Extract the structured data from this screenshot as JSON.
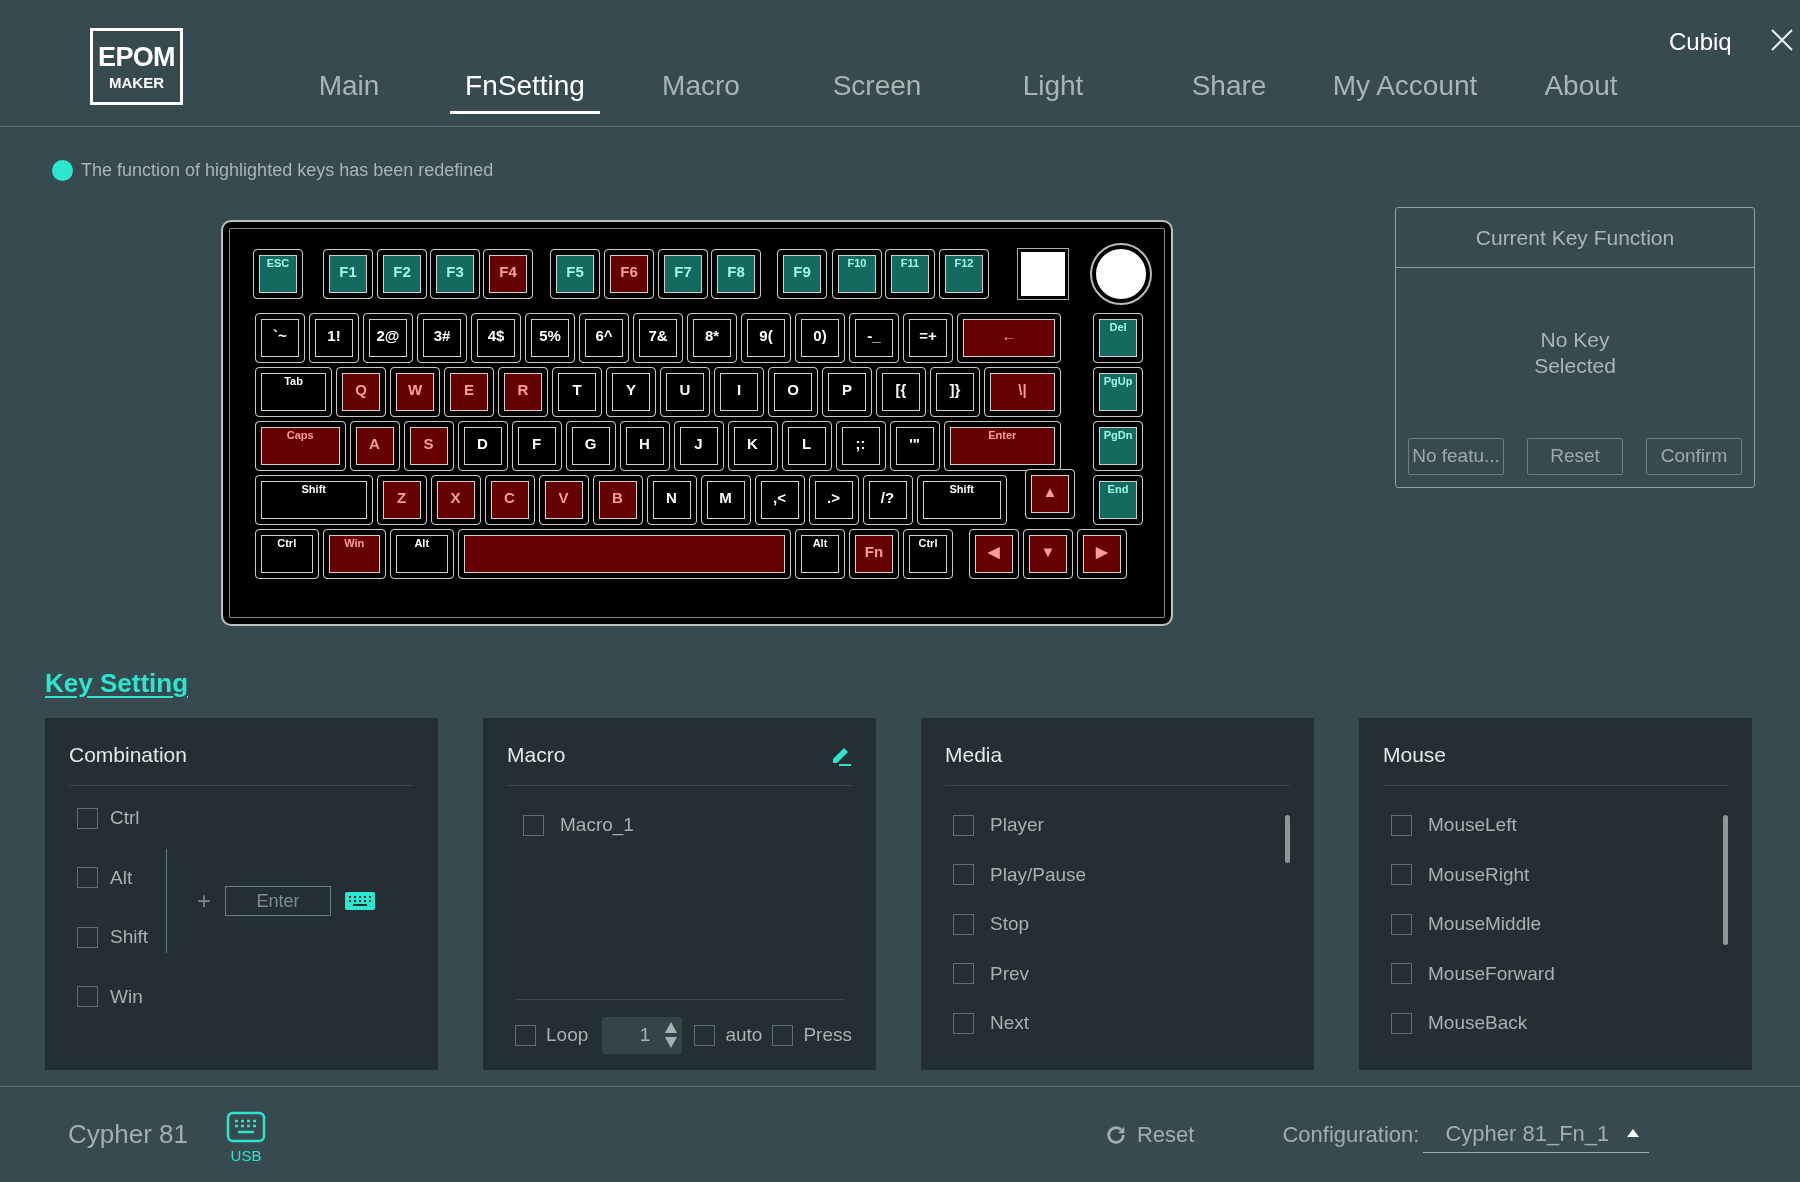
{
  "logo": {
    "line_1": "EPOM",
    "line_2": "MAKER"
  },
  "user_name": "Cubiq",
  "tabs": [
    {
      "label": "Main",
      "selected": false
    },
    {
      "label": "FnSetting",
      "selected": true
    },
    {
      "label": "Macro",
      "selected": false
    },
    {
      "label": "Screen",
      "selected": false
    },
    {
      "label": "Light",
      "selected": false
    },
    {
      "label": "Share",
      "selected": false
    },
    {
      "label": "My Account",
      "selected": false
    },
    {
      "label": "About",
      "selected": false
    }
  ],
  "notice": "The function of highlighted keys has been redefined",
  "keyboard": {
    "rows": [
      {
        "keys": [
          {
            "kind": "key",
            "label": "ESC",
            "color": "#136b5f"
          },
          {
            "kind": "key",
            "label": "F1",
            "color": "#136b5f"
          },
          {
            "kind": "key",
            "label": "F2",
            "color": "#136b5f"
          },
          {
            "kind": "key",
            "label": "F3",
            "color": "#136b5f"
          },
          {
            "kind": "key",
            "label": "F4",
            "color": "#650000"
          },
          {
            "kind": "key",
            "label": "F5",
            "color": "#136b5f"
          },
          {
            "kind": "key",
            "label": "F6",
            "color": "#650000"
          },
          {
            "kind": "key",
            "label": "F7",
            "color": "#136b5f"
          },
          {
            "kind": "key",
            "label": "F8",
            "color": "#136b5f"
          },
          {
            "kind": "key",
            "label": "F9",
            "color": "#136b5f"
          },
          {
            "kind": "key",
            "label": "F10",
            "color": "#136b5f"
          },
          {
            "kind": "key",
            "label": "F11",
            "color": "#136b5f"
          },
          {
            "kind": "key",
            "label": "F12",
            "color": "#136b5f"
          },
          {
            "kind": "screen"
          },
          {
            "kind": "knob"
          }
        ]
      },
      {
        "keys": [
          {
            "kind": "key",
            "label": "`~",
            "color": "#000000"
          },
          {
            "kind": "key",
            "label": "1!",
            "color": "#000000"
          },
          {
            "kind": "key",
            "label": "2@",
            "color": "#000000"
          },
          {
            "kind": "key",
            "label": "3#",
            "color": "#000000"
          },
          {
            "kind": "key",
            "label": "4$",
            "color": "#000000"
          },
          {
            "kind": "key",
            "label": "5%",
            "color": "#000000"
          },
          {
            "kind": "key",
            "label": "6^",
            "color": "#000000"
          },
          {
            "kind": "key",
            "label": "7&",
            "color": "#000000"
          },
          {
            "kind": "key",
            "label": "8*",
            "color": "#000000"
          },
          {
            "kind": "key",
            "label": "9(",
            "color": "#000000"
          },
          {
            "kind": "key",
            "label": "0)",
            "color": "#000000"
          },
          {
            "kind": "key",
            "label": "-_",
            "color": "#000000"
          },
          {
            "kind": "key",
            "label": "=+",
            "color": "#000000"
          },
          {
            "kind": "key",
            "label": "←",
            "color": "#650000"
          },
          {
            "kind": "key",
            "label": "Del",
            "color": "#136b5f"
          }
        ]
      },
      {
        "keys": [
          {
            "kind": "key",
            "label": "Tab",
            "color": "#000000"
          },
          {
            "kind": "key",
            "label": "Q",
            "color": "#650000"
          },
          {
            "kind": "key",
            "label": "W",
            "color": "#650000"
          },
          {
            "kind": "key",
            "label": "E",
            "color": "#650000"
          },
          {
            "kind": "key",
            "label": "R",
            "color": "#650000"
          },
          {
            "kind": "key",
            "label": "T",
            "color": "#000000"
          },
          {
            "kind": "key",
            "label": "Y",
            "color": "#000000"
          },
          {
            "kind": "key",
            "label": "U",
            "color": "#000000"
          },
          {
            "kind": "key",
            "label": "I",
            "color": "#000000"
          },
          {
            "kind": "key",
            "label": "O",
            "color": "#000000"
          },
          {
            "kind": "key",
            "label": "P",
            "color": "#000000"
          },
          {
            "kind": "key",
            "label": "[{",
            "color": "#000000"
          },
          {
            "kind": "key",
            "label": "]}",
            "color": "#000000"
          },
          {
            "kind": "key",
            "label": "\\|",
            "color": "#650000"
          },
          {
            "kind": "key",
            "label": "PgUp",
            "color": "#136b5f"
          }
        ]
      },
      {
        "keys": [
          {
            "kind": "key",
            "label": "Caps",
            "color": "#650000"
          },
          {
            "kind": "key",
            "label": "A",
            "color": "#650000"
          },
          {
            "kind": "key",
            "label": "S",
            "color": "#650000"
          },
          {
            "kind": "key",
            "label": "D",
            "color": "#000000"
          },
          {
            "kind": "key",
            "label": "F",
            "color": "#000000"
          },
          {
            "kind": "key",
            "label": "G",
            "color": "#000000"
          },
          {
            "kind": "key",
            "label": "H",
            "color": "#000000"
          },
          {
            "kind": "key",
            "label": "J",
            "color": "#000000"
          },
          {
            "kind": "key",
            "label": "K",
            "color": "#000000"
          },
          {
            "kind": "key",
            "label": "L",
            "color": "#000000"
          },
          {
            "kind": "key",
            "label": ";:",
            "color": "#000000"
          },
          {
            "kind": "key",
            "label": "'\"",
            "color": "#000000"
          },
          {
            "kind": "key",
            "label": "Enter",
            "color": "#650000"
          },
          {
            "kind": "key",
            "label": "PgDn",
            "color": "#136b5f"
          }
        ]
      },
      {
        "keys": [
          {
            "kind": "key",
            "label": "Shift",
            "color": "#000000"
          },
          {
            "kind": "key",
            "label": "Z",
            "color": "#650000"
          },
          {
            "kind": "key",
            "label": "X",
            "color": "#650000"
          },
          {
            "kind": "key",
            "label": "C",
            "color": "#650000"
          },
          {
            "kind": "key",
            "label": "V",
            "color": "#650000"
          },
          {
            "kind": "key",
            "label": "B",
            "color": "#650000"
          },
          {
            "kind": "key",
            "label": "N",
            "color": "#000000"
          },
          {
            "kind": "key",
            "label": "M",
            "color": "#000000"
          },
          {
            "kind": "key",
            "label": ",<",
            "color": "#000000"
          },
          {
            "kind": "key",
            "label": ".>",
            "color": "#000000"
          },
          {
            "kind": "key",
            "label": "/?",
            "color": "#000000"
          },
          {
            "kind": "key",
            "label": "Shift",
            "color": "#000000"
          },
          {
            "kind": "key",
            "label": "▲",
            "color": "#650000"
          },
          {
            "kind": "key",
            "label": "End",
            "color": "#136b5f"
          }
        ]
      },
      {
        "keys": [
          {
            "kind": "key",
            "label": "Ctrl",
            "color": "#000000"
          },
          {
            "kind": "key",
            "label": "Win",
            "color": "#650000"
          },
          {
            "kind": "key",
            "label": "Alt",
            "color": "#000000"
          },
          {
            "kind": "key",
            "color": "#650000"
          },
          {
            "kind": "key",
            "label": "Alt",
            "color": "#000000"
          },
          {
            "kind": "key",
            "label": "Fn",
            "color": "#650000"
          },
          {
            "kind": "key",
            "label": "Ctrl",
            "color": "#000000"
          },
          {
            "kind": "key",
            "label": "◀",
            "color": "#650000"
          },
          {
            "kind": "key",
            "label": "▼",
            "color": "#650000"
          },
          {
            "kind": "key",
            "label": "▶",
            "color": "#650000"
          }
        ]
      }
    ]
  },
  "current_key": {
    "title": "Current Key Function",
    "message": "No Key Selected",
    "buttons": [
      "No featu...",
      "Reset",
      "Confirm"
    ]
  },
  "key_setting": {
    "title": "Key Setting",
    "panels": [
      {
        "kind": "combination",
        "title": "Combination",
        "modifiers": [
          {
            "label": "Ctrl",
            "checked": false
          },
          {
            "label": "Alt",
            "checked": false
          },
          {
            "label": "Shift",
            "checked": false
          },
          {
            "label": "Win",
            "checked": false
          }
        ],
        "plus": "+",
        "key_field": {
          "value": "Enter"
        }
      },
      {
        "kind": "macro",
        "title": "Macro",
        "macros": [
          {
            "label": "Macro_1",
            "checked": false
          }
        ],
        "options": [
          {
            "label": "Loop",
            "checked": false
          },
          {
            "label": "auto",
            "checked": false
          },
          {
            "label": "Press",
            "checked": false
          }
        ],
        "count": "1"
      },
      {
        "kind": "list",
        "title": "Media",
        "items": [
          {
            "label": "Player",
            "checked": false
          },
          {
            "label": "Play/Pause",
            "checked": false
          },
          {
            "label": "Stop",
            "checked": false
          },
          {
            "label": "Prev",
            "checked": false
          },
          {
            "label": "Next",
            "checked": false
          }
        ]
      },
      {
        "kind": "list",
        "title": "Mouse",
        "items": [
          {
            "label": "MouseLeft",
            "checked": false
          },
          {
            "label": "MouseRight",
            "checked": false
          },
          {
            "label": "MouseMiddle",
            "checked": false
          },
          {
            "label": "MouseForward",
            "checked": false
          },
          {
            "label": "MouseBack",
            "checked": false
          }
        ]
      }
    ]
  },
  "status_bar": {
    "device": "Cypher 81",
    "connection": "USB",
    "reset": "Reset",
    "config_label": "Configuration:",
    "config_value": "Cypher 81_Fn_1"
  }
}
